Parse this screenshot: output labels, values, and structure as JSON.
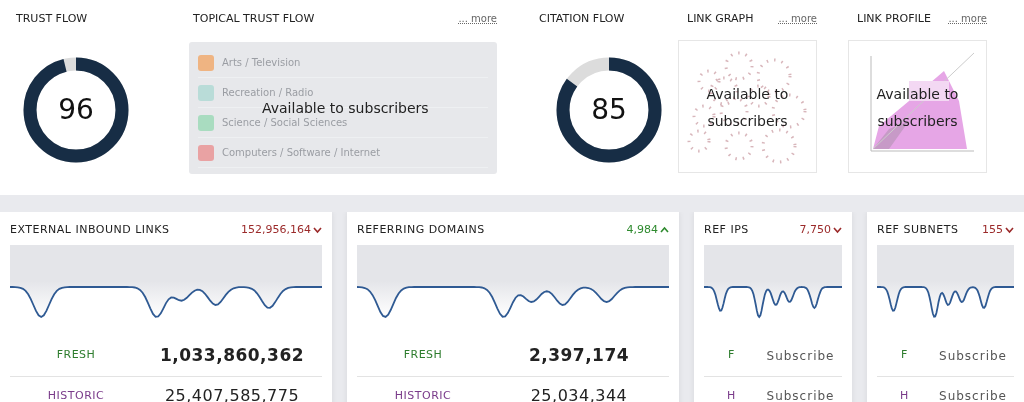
{
  "top_panel": {
    "trust_flow": {
      "title": "TRUST FLOW",
      "value": "96",
      "level": 0.96
    },
    "topical_trust_flow": {
      "title": "TOPICAL TRUST FLOW",
      "more_link": "... more",
      "overlay": "Available to subscribers",
      "topics": [
        {
          "label": "Arts / Television",
          "color": "#efb482"
        },
        {
          "label": "Recreation / Radio",
          "color": "#b9dcd8"
        },
        {
          "label": "Science / Social Sciences",
          "color": "#a9dcc0"
        },
        {
          "label": "Computers / Software / Internet",
          "color": "#e9a2a3"
        }
      ]
    },
    "citation_flow": {
      "title": "CITATION FLOW",
      "value": "85",
      "level": 0.85
    },
    "link_graph": {
      "title": "LINK GRAPH",
      "more_link": "... more",
      "overlay": "Available to subscribers"
    },
    "link_profile": {
      "title": "LINK PROFILE",
      "more_link": "... more",
      "overlay": "Available to subscribers"
    }
  },
  "metric_cards": [
    {
      "title": "EXTERNAL INBOUND LINKS",
      "change": "152,956,164",
      "rising": false,
      "locked": false,
      "rows": [
        {
          "label": "FRESH",
          "kind": "fresh",
          "value": "1,033,860,362"
        },
        {
          "label": "HISTORIC",
          "kind": "historic",
          "value": "25,407,585,775"
        }
      ]
    },
    {
      "title": "REFERRING DOMAINS",
      "change": "4,984",
      "rising": true,
      "locked": false,
      "rows": [
        {
          "label": "FRESH",
          "kind": "fresh",
          "value": "2,397,174"
        },
        {
          "label": "HISTORIC",
          "kind": "historic",
          "value": "25,034,344"
        }
      ]
    },
    {
      "title": "REF IPS",
      "change": "7,750",
      "rising": false,
      "locked": true,
      "rows": [
        {
          "label": "F",
          "kind": "fresh",
          "value": "Subscribe"
        },
        {
          "label": "H",
          "kind": "historic",
          "value": "Subscribe"
        }
      ]
    },
    {
      "title": "REF SUBNETS",
      "change": "155",
      "rising": false,
      "locked": true,
      "rows": [
        {
          "label": "F",
          "kind": "fresh",
          "value": "Subscribe"
        },
        {
          "label": "H",
          "kind": "historic",
          "value": "Subscribe"
        }
      ]
    }
  ]
}
